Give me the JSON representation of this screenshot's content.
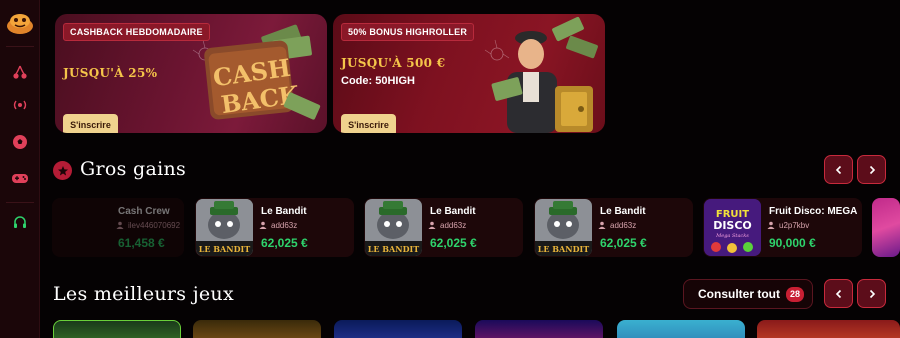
{
  "promos": [
    {
      "tag": "CASHBACK HEBDOMADAIRE",
      "amount": "JUSQU'À 25%",
      "code": "",
      "button": "S'inscrire",
      "art_text_1": "CASH",
      "art_text_2": "BACK"
    },
    {
      "tag": "50% BONUS HIGHROLLER",
      "amount": "JUSQU'À 500 €",
      "code": "Code: 50HIGH",
      "button": "S'inscrire"
    }
  ],
  "big_wins": {
    "title": "Gros gains",
    "items": [
      {
        "game": "Cash Crew",
        "user": "ilev446070692",
        "amount": "61,458 €"
      },
      {
        "game": "Le Bandit",
        "user": "add63z",
        "amount": "62,025 €"
      },
      {
        "game": "Le Bandit",
        "user": "add63z",
        "amount": "62,025 €"
      },
      {
        "game": "Le Bandit",
        "user": "add63z",
        "amount": "62,025 €"
      },
      {
        "game": "Fruit Disco: MEGA",
        "user": "u2p7kbv",
        "amount": "90,000 €"
      }
    ],
    "thumb_labels": {
      "bandit": "LE BANDIT",
      "fruit": "FRUIT",
      "disco": "DISCO",
      "mega": "Mega Stacks"
    }
  },
  "best_games": {
    "title": "Les meilleurs jeux",
    "see_all": "Consulter tout",
    "count": "28"
  },
  "colors": {
    "accent": "#c91f33",
    "gold": "#f5c54a",
    "win_green": "#2ed36c",
    "button_cream": "#f0d28e"
  },
  "icons": [
    "logo-icon",
    "cherry-icon",
    "live-signal-icon",
    "soccer-ball-icon",
    "gamepad-icon",
    "headset-icon",
    "star-icon",
    "chevron-left-icon",
    "chevron-right-icon",
    "user-icon"
  ]
}
